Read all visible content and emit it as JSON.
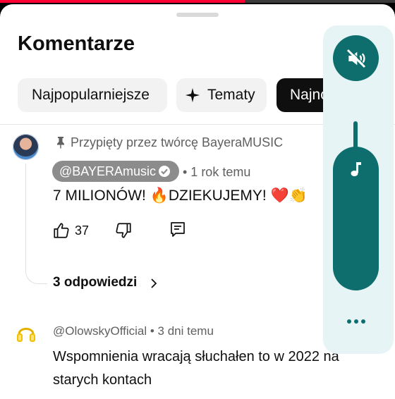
{
  "player": {
    "progress": 0.62
  },
  "sheet": {
    "title": "Komentarze",
    "chips": [
      {
        "label": "Najpopularniejsze"
      },
      {
        "label": "Tematy"
      },
      {
        "label": "Najno"
      }
    ]
  },
  "comments": [
    {
      "pinned_text": "Przypięty przez twórcę BayeraMUSIC",
      "author": "@BAYERAmusic",
      "time": "• 1 rok temu",
      "text": "7 MILIONÓW! 🔥DZIEKUJEMY! ❤️👏",
      "likes": "37",
      "replies": "3 odpowiedzi"
    },
    {
      "author_meta": "@OlowskyOfficial • 3 dni temu",
      "text": "Wspomnienia wracają słuchałen to w 2022 na starych kontach"
    }
  ],
  "volume": {
    "level": 0.0
  },
  "colors": {
    "accent": "#0d6e6d",
    "progress": "#ff0033",
    "panel": "#e7f4f5"
  }
}
